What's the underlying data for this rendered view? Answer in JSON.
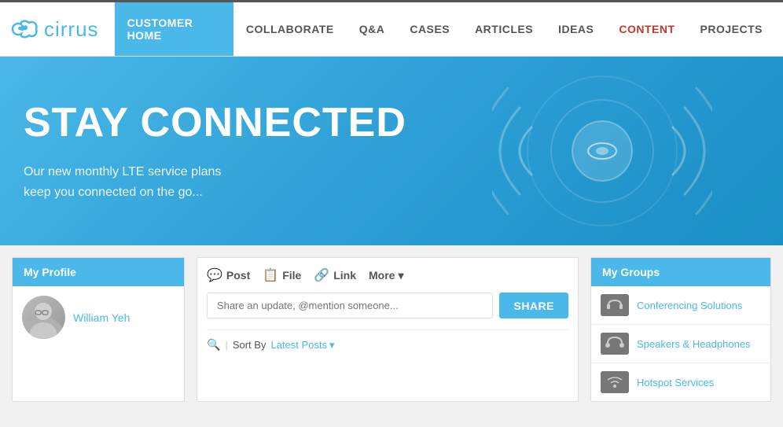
{
  "header": {
    "logo_text": "cirrus",
    "nav_items": [
      {
        "label": "CUSTOMER HOME",
        "active": true,
        "id": "customer-home"
      },
      {
        "label": "COLLABORATE",
        "active": false,
        "id": "collaborate"
      },
      {
        "label": "Q&A",
        "active": false,
        "id": "qa"
      },
      {
        "label": "CASES",
        "active": false,
        "id": "cases"
      },
      {
        "label": "ARTICLES",
        "active": false,
        "id": "articles"
      },
      {
        "label": "IDEAS",
        "active": false,
        "id": "ideas"
      },
      {
        "label": "CONTENT",
        "active": false,
        "id": "content",
        "special": true
      },
      {
        "label": "PROJECTS",
        "active": false,
        "id": "projects"
      }
    ]
  },
  "hero": {
    "title": "STAY CONNECTED",
    "subtitle_line1": "Our new monthly LTE service plans",
    "subtitle_line2": "keep you connected on the go..."
  },
  "profile": {
    "panel_title": "My Profile",
    "user_name": "William Yeh"
  },
  "feed": {
    "actions": [
      {
        "label": "Post",
        "icon": "💬"
      },
      {
        "label": "File",
        "icon": "📋"
      },
      {
        "label": "Link",
        "icon": "🔗"
      }
    ],
    "more_label": "More",
    "share_placeholder": "Share an update, @mention someone...",
    "share_button": "SHARE",
    "sort_label": "Sort By",
    "sort_value": "Latest Posts"
  },
  "groups": {
    "panel_title": "My Groups",
    "items": [
      {
        "name": "Conferencing Solutions",
        "icon_bg": "#888"
      },
      {
        "name": "Speakers & Headphones",
        "icon_bg": "#888"
      },
      {
        "name": "Hotspot Services",
        "icon_bg": "#888"
      }
    ]
  }
}
